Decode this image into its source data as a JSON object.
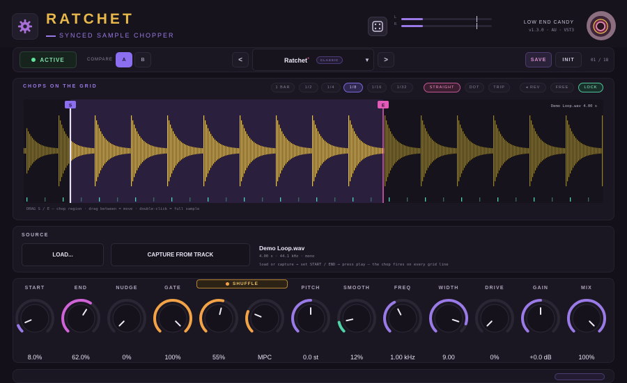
{
  "header": {
    "title": "RATCHET",
    "tagline": "SYNCED SAMPLE CHOPPER",
    "brand": "LOW END CANDY",
    "version": "v1.3.0 · AU · VST3",
    "meters": [
      {
        "label": "L",
        "level": 0.24
      },
      {
        "label": "R",
        "level": 0.24
      }
    ]
  },
  "toolbar": {
    "active_label": "ACTIVE",
    "compare_label": "COMPARE",
    "ab_a": "A",
    "ab_b": "B",
    "prev_label": "<",
    "next_label": ">",
    "preset_name": "Ratchet",
    "preset_modified": "*",
    "preset_tag": "CLASSIC",
    "save_label": "SAVE",
    "init_label": "INIT",
    "preset_counter": "01 / 18"
  },
  "grid": {
    "title": "CHOPS ON THE GRID",
    "divisions": [
      "1 BAR",
      "1/2",
      "1/4",
      "1/8",
      "1/16",
      "1/32"
    ],
    "selected_division": "1/8",
    "feel": [
      "STRAIGHT",
      "DOT",
      "TRIP"
    ],
    "selected_feel": "STRAIGHT",
    "modes": [
      "◂ REV",
      "FREE",
      "LOCK"
    ],
    "selected_mode": "LOCK",
    "start_marker": "S",
    "end_marker": "E",
    "file_readout": "Demo Loop.wav  4.00 s",
    "start_fraction": 0.08,
    "end_fraction": 0.62,
    "hint": "DRAG S / E — chop region · drag between = move · double-click = full sample"
  },
  "source": {
    "label": "SOURCE",
    "load_label": "LOAD...",
    "capture_label": "CAPTURE FROM TRACK",
    "file_name": "Demo Loop.wav",
    "file_meta": "4.00 s  ·  44.1 kHz  ·  mono",
    "hint": "load or capture → set START / END → press play — the chop fires on every grid line"
  },
  "shuffle_label": "SHUFFLE",
  "knobs": [
    {
      "name": "start",
      "label": "START",
      "value": "8.0%",
      "level": 0.08,
      "color": "#9a7ae6"
    },
    {
      "name": "end",
      "label": "END",
      "value": "62.0%",
      "level": 0.62,
      "color": "#d063d8"
    },
    {
      "name": "nudge",
      "label": "NUDGE",
      "value": "0%",
      "level": 0.0,
      "color": "#9a7ae6"
    },
    {
      "name": "gate",
      "label": "GATE",
      "value": "100%",
      "level": 1.0,
      "color": "#f3a347"
    },
    {
      "name": "shuffle",
      "label": "",
      "value": "55%",
      "level": 0.55,
      "color": "#f3a347"
    },
    {
      "name": "feel",
      "label": "",
      "value": "MPC",
      "level": 0.25,
      "color": "#f3a347"
    },
    {
      "name": "pitch",
      "label": "PITCH",
      "value": "0.0 st",
      "level": 0.5,
      "color": "#9a7ae6"
    },
    {
      "name": "smooth",
      "label": "SMOOTH",
      "value": "12%",
      "level": 0.12,
      "color": "#4fd4a8"
    },
    {
      "name": "freq",
      "label": "FREQ",
      "value": "1.00 kHz",
      "level": 0.4,
      "color": "#9a7ae6"
    },
    {
      "name": "width",
      "label": "WIDTH",
      "value": "9.00",
      "level": 0.9,
      "color": "#9a7ae6"
    },
    {
      "name": "drive",
      "label": "DRIVE",
      "value": "0%",
      "level": 0.0,
      "color": "#9a7ae6"
    },
    {
      "name": "gain",
      "label": "GAIN",
      "value": "+0.0 dB",
      "level": 0.5,
      "color": "#9a7ae6"
    },
    {
      "name": "mix",
      "label": "MIX",
      "value": "100%",
      "level": 1.0,
      "color": "#9a7ae6"
    }
  ]
}
